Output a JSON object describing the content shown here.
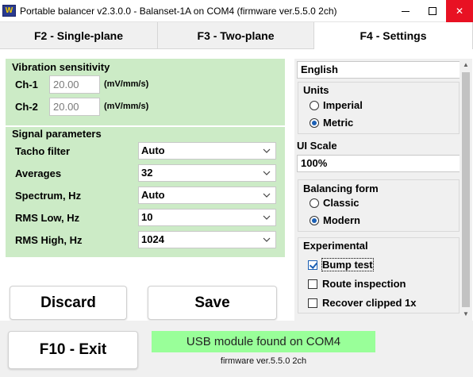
{
  "window": {
    "icon_text": "W",
    "title": "Portable balancer v2.3.0.0 - Balanset-1A on COM4 (firmware ver.5.5.0 2ch)",
    "close_glyph": "✕"
  },
  "tabs": [
    {
      "label": "F2 - Single-plane",
      "active": false
    },
    {
      "label": "F3 - Two-plane",
      "active": false
    },
    {
      "label": "F4 - Settings",
      "active": true
    }
  ],
  "vibration": {
    "title": "Vibration sensitivity",
    "ch1": {
      "label": "Ch-1",
      "value": "20.00",
      "unit": "(mV/mm/s)"
    },
    "ch2": {
      "label": "Ch-2",
      "value": "20.00",
      "unit": "(mV/mm/s)"
    }
  },
  "signal": {
    "title": "Signal parameters",
    "rows": [
      {
        "label": "Tacho filter",
        "value": "Auto"
      },
      {
        "label": "Averages",
        "value": "32"
      },
      {
        "label": "Spectrum, Hz",
        "value": "Auto"
      },
      {
        "label": "RMS Low, Hz",
        "value": "10"
      },
      {
        "label": "RMS High, Hz",
        "value": "1024"
      }
    ]
  },
  "buttons": {
    "discard": "Discard",
    "save": "Save",
    "exit": "F10 - Exit"
  },
  "settings": {
    "language": "English",
    "units": {
      "title": "Units",
      "options": [
        {
          "label": "Imperial",
          "selected": false
        },
        {
          "label": "Metric",
          "selected": true
        }
      ]
    },
    "ui_scale": {
      "label": "UI Scale",
      "value": "100%"
    },
    "balancing_form": {
      "title": "Balancing form",
      "options": [
        {
          "label": "Classic",
          "selected": false
        },
        {
          "label": "Modern",
          "selected": true
        }
      ]
    },
    "experimental": {
      "title": "Experimental",
      "options": [
        {
          "label": "Bump test",
          "checked": true
        },
        {
          "label": "Route inspection",
          "checked": false
        },
        {
          "label": "Recover clipped 1x",
          "checked": false
        }
      ]
    }
  },
  "status": {
    "message": "USB module found on COM4",
    "firmware": "firmware ver.5.5.0 2ch",
    "color": "#99ff99"
  },
  "colors": {
    "panel_green": "#ccebc6",
    "accent": "#1a5fb4",
    "close_red": "#e81123"
  }
}
